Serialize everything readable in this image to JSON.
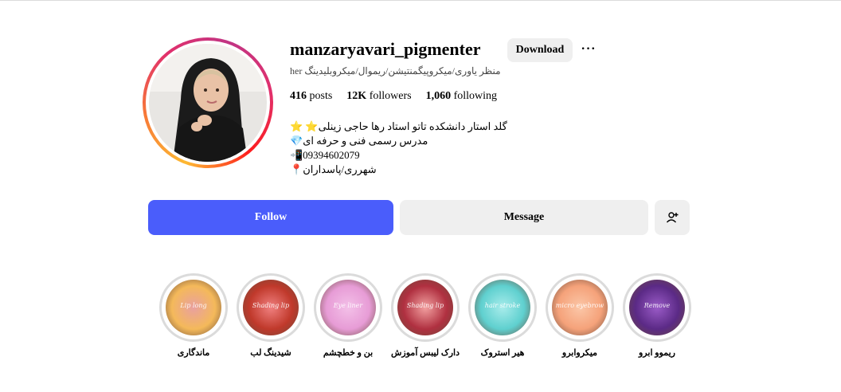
{
  "profile": {
    "username": "manzaryavari_pigmenter",
    "download_label": "Download",
    "more_label": "···",
    "category_line": "her منظر یاوری/میکروپیگمنتیشن/ریموال/میکروبلیدینگ",
    "stats": {
      "posts_count": "416",
      "posts_label": "posts",
      "followers_count": "12K",
      "followers_label": "followers",
      "following_count": "1,060",
      "following_label": "following"
    },
    "bio": [
      "⭐ ⭐گلد استار دانشکده تاتو استاد رها حاجی زینلی",
      "💎مدرس رسمی فنی و حرفه ای",
      "📲09394602079",
      "📍شهرری/پاسداران"
    ]
  },
  "actions": {
    "follow_label": "Follow",
    "message_label": "Message",
    "add_user_icon": "add-user-icon"
  },
  "highlights": [
    {
      "label": "ماندگاری",
      "text": "Lip long",
      "colors": [
        "#f4b95a",
        "#e9a0a0"
      ]
    },
    {
      "label": "شیدینگ لب",
      "text": "Shading lip",
      "colors": [
        "#c0392b",
        "#f08080"
      ]
    },
    {
      "label": "بن و خطچشم",
      "text": "Eye liner",
      "colors": [
        "#e79cd6",
        "#f3c0e8"
      ]
    },
    {
      "label": "دارک لیبس آموزش",
      "text": "Shading lip",
      "colors": [
        "#b03040",
        "#f2a0a0"
      ]
    },
    {
      "label": "هیر استروک",
      "text": "hair stroke",
      "colors": [
        "#5fd0cf",
        "#a8eceb"
      ]
    },
    {
      "label": "میکروابرو",
      "text": "micro eyebrow",
      "colors": [
        "#f5a27a",
        "#fbc7a8"
      ]
    },
    {
      "label": "ریموو ابرو",
      "text": "Remove",
      "colors": [
        "#5b2a86",
        "#9a5bc7"
      ]
    }
  ]
}
